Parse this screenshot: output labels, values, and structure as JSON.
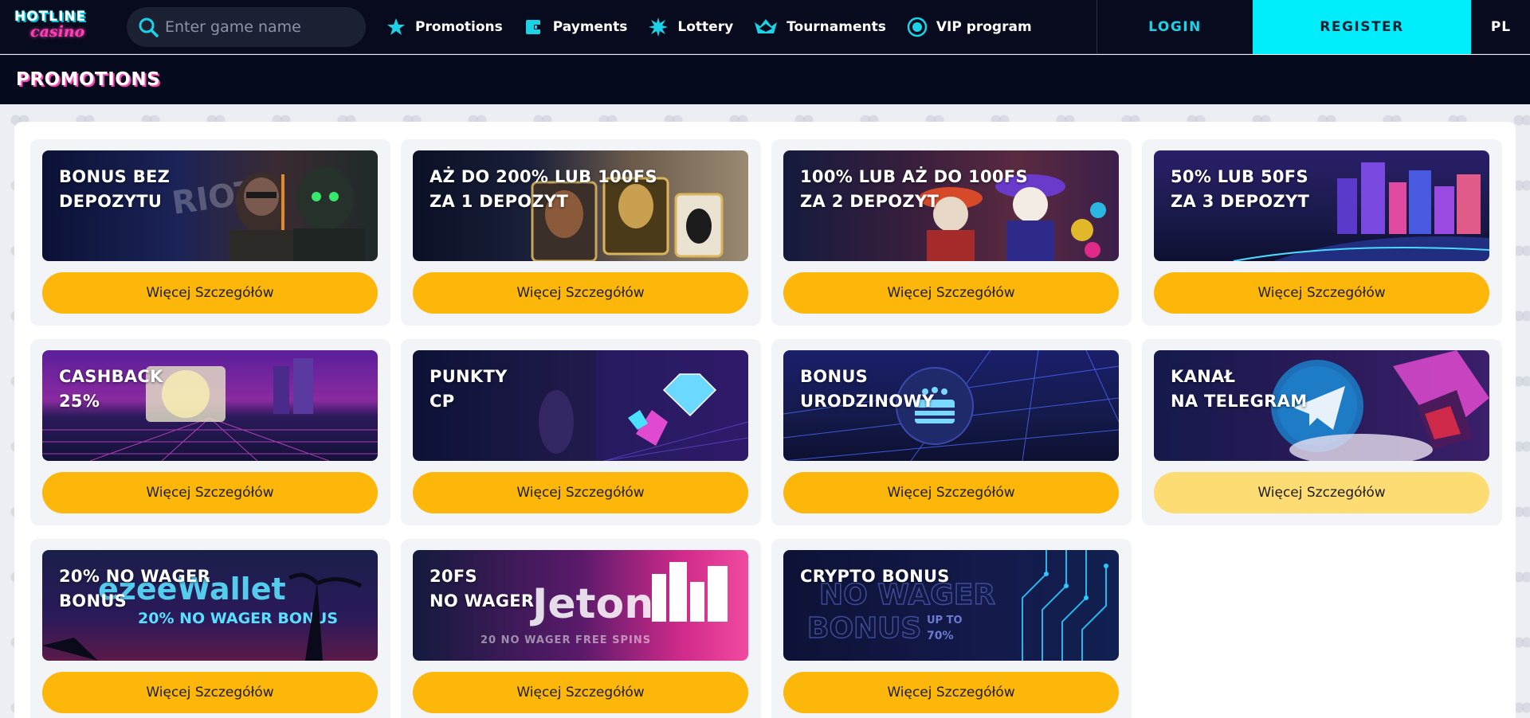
{
  "brand": {
    "logo_line1": "HOTLINE",
    "logo_line2": "casino"
  },
  "search": {
    "placeholder": "Enter game name"
  },
  "nav": [
    {
      "label": "Promotions",
      "icon": "star-icon"
    },
    {
      "label": "Payments",
      "icon": "wallet-icon"
    },
    {
      "label": "Lottery",
      "icon": "burst-icon"
    },
    {
      "label": "Tournaments",
      "icon": "crown-icon"
    },
    {
      "label": "VIP program",
      "icon": "vip-gem-icon"
    }
  ],
  "auth": {
    "login": "LOGIN",
    "register": "REGISTER",
    "language": "PL"
  },
  "page": {
    "title": "PROMOTIONS"
  },
  "colors": {
    "accent_cyan": "#00eefc",
    "button_yellow": "#fdb70a",
    "button_yellow_hover": "#fddd73",
    "header_bg": "#070b1d",
    "title_shadow_pink": "#ff3fb4"
  },
  "promotions": [
    {
      "title": "BONUS BEZ\nDEPOZYTU",
      "button": "Więcej Szczegółów",
      "theme": "riot-soldiers"
    },
    {
      "title": "AŻ DO 200% LUB 100FS\nZA 1 DEPOZYT",
      "button": "Więcej Szczegółów",
      "theme": "egyptian-cards"
    },
    {
      "title": "100% LUB AŻ DO 100FS\nZA 2 DEPOZYT",
      "button": "Więcej Szczegółów",
      "theme": "skeleton-mariachi"
    },
    {
      "title": "50% LUB 50FS\nZA 3 DEPOZYT",
      "button": "Więcej Szczegółów",
      "theme": "neon-city"
    },
    {
      "title": "CASHBACK\n25%",
      "button": "Więcej Szczegółów",
      "theme": "neon-safe"
    },
    {
      "title": "PUNKTY\nCP",
      "button": "Więcej Szczegółów",
      "theme": "neon-diamond"
    },
    {
      "title": "BONUS\nURODZINOWY",
      "button": "Więcej Szczegółów",
      "theme": "birthday-cake"
    },
    {
      "title": "KANAŁ\nNA TELEGRAM",
      "button": "Więcej Szczegółów",
      "theme": "telegram"
    },
    {
      "title": "20% NO WAGER\nBONUS",
      "button": "Więcej Szczegółów",
      "theme": "ezeewallet",
      "art_text_1": "ezeeWallet",
      "art_text_2": "20% NO WAGER BONUS"
    },
    {
      "title": "20FS\nNO WAGER",
      "button": "Więcej Szczegółów",
      "theme": "jeton",
      "art_text_1": "Jeton",
      "art_text_2": "20 NO WAGER FREE SPINS"
    },
    {
      "title": "CRYPTO BONUS",
      "button": "Więcej Szczegółów",
      "theme": "crypto",
      "art_text_1": "NO WAGER",
      "art_text_2": "BONUS",
      "art_text_3": "UP TO",
      "art_text_4": "70%"
    }
  ]
}
